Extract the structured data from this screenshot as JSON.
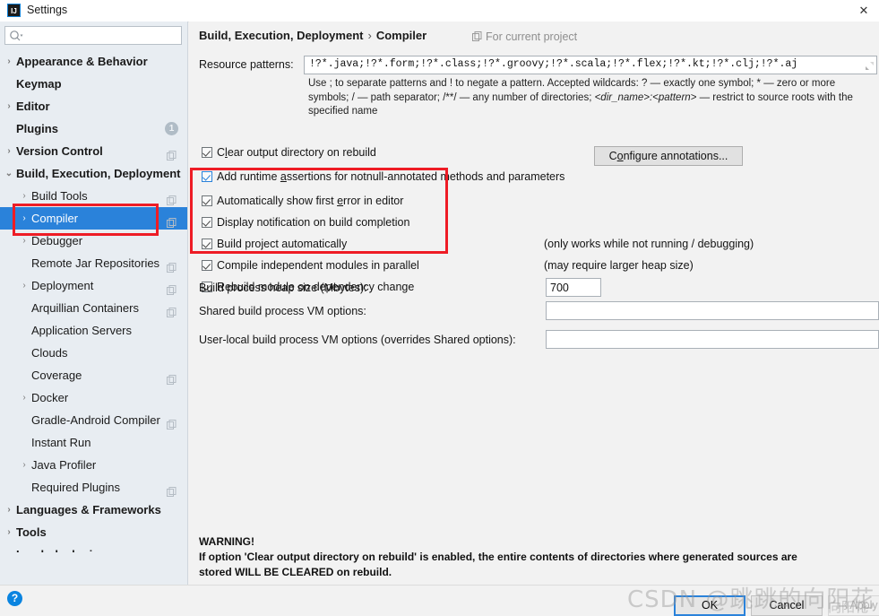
{
  "window": {
    "title": "Settings",
    "app_icon": "IJ",
    "close_icon": "✕"
  },
  "search": {
    "value": "",
    "placeholder": "",
    "icon": "search-icon"
  },
  "sidebar": {
    "items": [
      {
        "label": "Appearance & Behavior",
        "arrow": "›",
        "indent": 18,
        "bold": true,
        "copy": false,
        "badge": null,
        "selected": false
      },
      {
        "label": "Keymap",
        "arrow": "",
        "indent": 18,
        "bold": true,
        "copy": false,
        "badge": null,
        "selected": false
      },
      {
        "label": "Editor",
        "arrow": "›",
        "indent": 18,
        "bold": true,
        "copy": false,
        "badge": null,
        "selected": false
      },
      {
        "label": "Plugins",
        "arrow": "",
        "indent": 18,
        "bold": true,
        "copy": false,
        "badge": "1",
        "selected": false
      },
      {
        "label": "Version Control",
        "arrow": "›",
        "indent": 18,
        "bold": true,
        "copy": true,
        "badge": null,
        "selected": false
      },
      {
        "label": "Build, Execution, Deployment",
        "arrow": "⌄",
        "indent": 18,
        "bold": true,
        "copy": false,
        "badge": null,
        "selected": false
      },
      {
        "label": "Build Tools",
        "arrow": "›",
        "indent": 35,
        "bold": false,
        "copy": true,
        "badge": null,
        "selected": false
      },
      {
        "label": "Compiler",
        "arrow": "›",
        "indent": 35,
        "bold": false,
        "copy": true,
        "badge": null,
        "selected": true
      },
      {
        "label": "Debugger",
        "arrow": "›",
        "indent": 35,
        "bold": false,
        "copy": false,
        "badge": null,
        "selected": false
      },
      {
        "label": "Remote Jar Repositories",
        "arrow": "",
        "indent": 35,
        "bold": false,
        "copy": true,
        "badge": null,
        "selected": false
      },
      {
        "label": "Deployment",
        "arrow": "›",
        "indent": 35,
        "bold": false,
        "copy": true,
        "badge": null,
        "selected": false
      },
      {
        "label": "Arquillian Containers",
        "arrow": "",
        "indent": 35,
        "bold": false,
        "copy": true,
        "badge": null,
        "selected": false
      },
      {
        "label": "Application Servers",
        "arrow": "",
        "indent": 35,
        "bold": false,
        "copy": false,
        "badge": null,
        "selected": false
      },
      {
        "label": "Clouds",
        "arrow": "",
        "indent": 35,
        "bold": false,
        "copy": false,
        "badge": null,
        "selected": false
      },
      {
        "label": "Coverage",
        "arrow": "",
        "indent": 35,
        "bold": false,
        "copy": true,
        "badge": null,
        "selected": false
      },
      {
        "label": "Docker",
        "arrow": "›",
        "indent": 35,
        "bold": false,
        "copy": false,
        "badge": null,
        "selected": false
      },
      {
        "label": "Gradle-Android Compiler",
        "arrow": "",
        "indent": 35,
        "bold": false,
        "copy": true,
        "badge": null,
        "selected": false
      },
      {
        "label": "Instant Run",
        "arrow": "",
        "indent": 35,
        "bold": false,
        "copy": false,
        "badge": null,
        "selected": false
      },
      {
        "label": "Java Profiler",
        "arrow": "›",
        "indent": 35,
        "bold": false,
        "copy": false,
        "badge": null,
        "selected": false
      },
      {
        "label": "Required Plugins",
        "arrow": "",
        "indent": 35,
        "bold": false,
        "copy": true,
        "badge": null,
        "selected": false
      },
      {
        "label": "Languages & Frameworks",
        "arrow": "›",
        "indent": 18,
        "bold": true,
        "copy": false,
        "badge": null,
        "selected": false
      },
      {
        "label": "Tools",
        "arrow": "›",
        "indent": 18,
        "bold": true,
        "copy": false,
        "badge": null,
        "selected": false
      },
      {
        "label": "Lombok plugin",
        "arrow": "",
        "indent": 18,
        "bold": true,
        "copy": true,
        "badge": null,
        "selected": false
      }
    ]
  },
  "main": {
    "breadcrumb_root": "Build, Execution, Deployment",
    "breadcrumb_sep": "›",
    "breadcrumb_leaf": "Compiler",
    "for_current_project": "For current project",
    "for_current_project_icon": "copy-icon",
    "resource_patterns_label": "Resource patterns:",
    "resource_patterns_value": "!?*.java;!?*.form;!?*.class;!?*.groovy;!?*.scala;!?*.flex;!?*.kt;!?*.clj;!?*.aj",
    "help_line1": "Use ; to separate patterns and ! to negate a pattern. Accepted wildcards: ? — exactly one symbol; * — zero or more",
    "help_line2a": "symbols; / — path separator; /**/ — any number of directories; ",
    "help_line2b": "<dir_name>:<pattern>",
    "help_line2c": " — restrict to source roots with the",
    "help_line3": "specified name",
    "checkboxes": [
      {
        "label_pre": "C",
        "label_u": "l",
        "label_post": "ear output directory on rebuild",
        "checked": true,
        "style": "grey"
      },
      {
        "label_pre": "Add runtime ",
        "label_u": "a",
        "label_post": "ssertions for notnull-annotated methods and parameters",
        "checked": true,
        "style": "blue"
      },
      {
        "label_pre": "Automatically show first ",
        "label_u": "e",
        "label_post": "rror in editor",
        "checked": true,
        "style": "grey"
      },
      {
        "label_pre": "Display notification on build completion",
        "label_u": "",
        "label_post": "",
        "checked": true,
        "style": "grey"
      },
      {
        "label_pre": "Build project automatically",
        "label_u": "",
        "label_post": "",
        "checked": true,
        "style": "grey"
      },
      {
        "label_pre": "Compile independent modules in parallel",
        "label_u": "",
        "label_post": "",
        "checked": true,
        "style": "grey"
      },
      {
        "label_pre": "Rebuild module on dependency change",
        "label_u": "",
        "label_post": "",
        "checked": true,
        "style": "grey"
      }
    ],
    "configure_annotations_pre": "C",
    "configure_annotations_u": "o",
    "configure_annotations_post": "nfigure annotations...",
    "note_build_auto": "(only works while not running / debugging)",
    "note_parallel": "(may require larger heap size)",
    "heap_label": "Build process heap size (Mbytes):",
    "heap_value": "700",
    "shared_vm_label": "Shared build process VM options:",
    "shared_vm_value": "",
    "userlocal_vm_label": "User-local build process VM options (overrides Shared options):",
    "userlocal_vm_value": "",
    "warning_title": "WARNING!",
    "warning_line1": "If option 'Clear output directory on rebuild' is enabled, the entire contents of directories where generated sources are",
    "warning_line2": "stored WILL BE CLEARED on rebuild."
  },
  "footer": {
    "help_icon": "?",
    "ok_label": "OK",
    "cancel_label": "Cancel",
    "apply_label": "Apply"
  },
  "watermark": {
    "text": "CSDN @跳跳的向阳花",
    "text2": "向阳花"
  },
  "colors": {
    "accent": "#2a82da",
    "annotation": "#ee1c25",
    "sidebar_bg": "#e8edf2",
    "content_bg": "#f2f2f2"
  }
}
